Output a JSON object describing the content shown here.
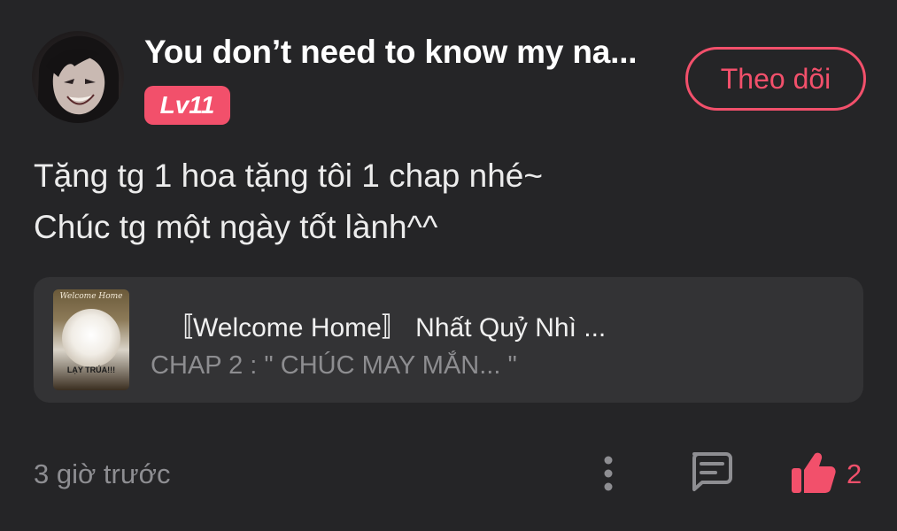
{
  "post": {
    "username": "You don’t need to know my na...",
    "level": "Lv11",
    "follow_label": "Theo dõi",
    "comment_lines": [
      "Tặng tg 1 hoa tặng tôi 1 chap nhé~",
      "Chúc tg một ngày tốt lành^^"
    ],
    "book": {
      "cover_top_text": "Welcome Home",
      "cover_bottom_text": "LẠY TRÚA!!!",
      "title": "〚Welcome Home〛 Nhất Quỷ Nhì ...",
      "chapter": "CHAP 2 : \" CHÚC MAY MẮN... \""
    },
    "timestamp": "3 giờ trước",
    "like_count": "2"
  },
  "icons": {
    "more": "more-vertical-icon",
    "reply": "comment-icon",
    "like": "thumbs-up-icon"
  },
  "colors": {
    "background": "#252527",
    "card": "#333335",
    "accent": "#f2506b",
    "muted_text": "#8e8e92"
  }
}
